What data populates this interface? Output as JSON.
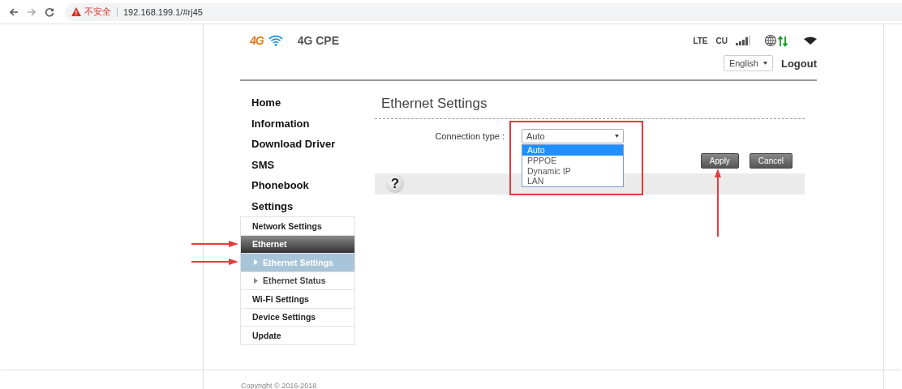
{
  "browser": {
    "security_label": "不安全",
    "url": "192.168.199.1/#rj45"
  },
  "header": {
    "logo": "4G",
    "title": "4G CPE",
    "network_type": "LTE",
    "carrier": "CU",
    "language": "English",
    "logout": "Logout"
  },
  "sidebar": {
    "items": [
      {
        "label": "Home",
        "selected": false
      },
      {
        "label": "Information",
        "selected": false
      },
      {
        "label": "Download Driver",
        "selected": false
      },
      {
        "label": "SMS",
        "selected": false
      },
      {
        "label": "Phonebook",
        "selected": false
      },
      {
        "label": "Settings",
        "selected": false,
        "children": [
          {
            "label": "Network Settings",
            "selected": false,
            "marked": false
          },
          {
            "label": "Ethernet",
            "selected": false,
            "expanded": true,
            "marked": true,
            "children": [
              {
                "label": "Ethernet Settings",
                "selected": true,
                "marked": true
              },
              {
                "label": "Ethernet Status",
                "selected": false,
                "marked": false
              }
            ]
          },
          {
            "label": "Wi-Fi Settings",
            "selected": false,
            "marked": false
          },
          {
            "label": "Device Settings",
            "selected": false,
            "marked": false
          },
          {
            "label": "Update",
            "selected": false,
            "marked": false
          }
        ]
      }
    ]
  },
  "main": {
    "title": "Ethernet Settings",
    "form": {
      "label": "Connection type :",
      "value": "Auto",
      "marked": true,
      "options": [
        {
          "label": "Auto",
          "selected": true
        },
        {
          "label": "PPPOE",
          "selected": false
        },
        {
          "label": "Dynamic IP",
          "selected": false
        },
        {
          "label": "LAN",
          "selected": false
        }
      ]
    },
    "buttons": [
      {
        "label": "Apply",
        "marked": true
      },
      {
        "label": "Cancel",
        "marked": false
      }
    ],
    "help": "?"
  },
  "footer": {
    "copyright": "Copyright © 2016-2018"
  }
}
